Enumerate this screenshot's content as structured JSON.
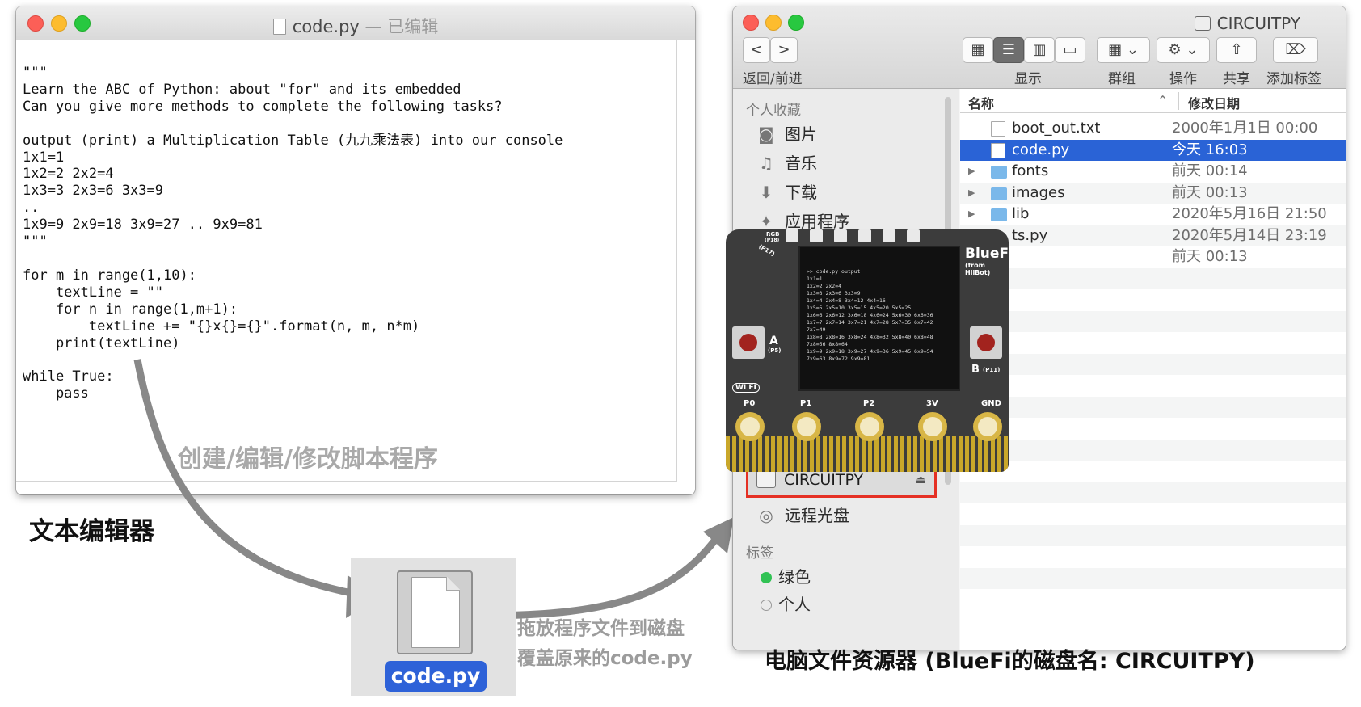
{
  "editor": {
    "title_file": "code.py",
    "title_status": " — 已编辑",
    "code_lines": [
      "\"\"\"",
      "Learn the ABC of Python: about \"for\" and its embedded",
      "Can you give more methods to complete the following tasks?",
      "",
      "output (print) a Multiplication Table (九九乘法表) into our console",
      "1x1=1",
      "1x2=2 2x2=4",
      "1x3=3 2x3=6 3x3=9",
      "..",
      "1x9=9 2x9=18 3x9=27 .. 9x9=81",
      "\"\"\"",
      "",
      "for m in range(1,10):",
      "    textLine = \"\"",
      "    for n in range(1,m+1):",
      "        textLine += \"{}x{}={}\".format(n, m, n*m)",
      "    print(textLine)",
      "",
      "while True:",
      "    pass"
    ],
    "caption": "创建/编辑/修改脚本程序",
    "label": "文本编辑器"
  },
  "drag": {
    "file_label": "code.py",
    "caption_line1": "拖放程序文件到磁盘",
    "caption_line2": "覆盖原来的code.py"
  },
  "finder": {
    "title": "CIRCUITPY",
    "toolbar": {
      "back": "<",
      "forward": ">",
      "back_forward_label": "返回/前进",
      "view_label": "显示",
      "group_label": "群组",
      "action_label": "操作",
      "share_label": "共享",
      "tag_label": "添加标签"
    },
    "sidebar": {
      "favorites_head": "个人收藏",
      "favorites": [
        {
          "icon": "camera-icon",
          "glyph": "◙",
          "label": "图片"
        },
        {
          "icon": "music-icon",
          "glyph": "♫",
          "label": "音乐"
        },
        {
          "icon": "download-icon",
          "glyph": "⬇",
          "label": "下载"
        },
        {
          "icon": "apps-icon",
          "glyph": "✦",
          "label": "应用程序"
        }
      ],
      "device": "CIRCUITPY",
      "eject": "⏏",
      "remote_disc": "远程光盘",
      "tags_head": "标签",
      "tag_green": "绿色",
      "tag_personal": "个人"
    },
    "list": {
      "col_name": "名称",
      "col_date": "修改日期",
      "rows": [
        {
          "type": "file",
          "name": "boot_out.txt",
          "date": "2000年1月1日 00:00",
          "expand": ""
        },
        {
          "type": "file",
          "name": "code.py",
          "date": "今天 16:03",
          "expand": ""
        },
        {
          "type": "folder",
          "name": "fonts",
          "date": "前天 00:14",
          "expand": "▶"
        },
        {
          "type": "folder",
          "name": "images",
          "date": "前天 00:13",
          "expand": "▶"
        },
        {
          "type": "folder",
          "name": "lib",
          "date": "2020年5月16日 21:50",
          "expand": "▶"
        },
        {
          "type": "file",
          "name": "ts.py",
          "date": "2020年5月14日 23:19",
          "expand": ""
        },
        {
          "type": "file",
          "name": "",
          "date": "前天 00:13",
          "expand": ""
        }
      ]
    },
    "caption": "电脑文件资源器 (BlueFi的磁盘名: CIRCUITPY)"
  },
  "board": {
    "name": "BlueFi",
    "maker": "(from HiiBot)",
    "rgb_label": "RGB",
    "rgb_pin": "(P18)",
    "p17": "(P17)",
    "wifi": "WI FI",
    "button_a": "A",
    "button_a_pin": "(P5)",
    "button_b": "B",
    "button_b_pin": "(P11)",
    "pins": [
      "P0",
      "P1",
      "P2",
      "3V",
      "GND"
    ],
    "screen_lines": [
      ">> code.py output:",
      "1x1=1",
      "1x2=2 2x2=4",
      "1x3=3 2x3=6 3x3=9",
      "1x4=4 2x4=8 3x4=12 4x4=16",
      "1x5=5 2x5=10 3x5=15 4x5=20 5x5=25",
      "1x6=6 2x6=12 3x6=18 4x6=24 5x6=30 6x6=36",
      "1x7=7 2x7=14 3x7=21 4x7=28 5x7=35 6x7=42",
      "7x7=49",
      "1x8=8 2x8=16 3x8=24 4x8=32 5x8=40 6x8=48",
      "7x8=56 8x8=64",
      "1x9=9 2x9=18 3x9=27 4x9=36 5x9=45 6x9=54",
      "7x9=63 8x9=72 9x9=81"
    ]
  },
  "colors": {
    "selection": "#2a63d6",
    "highlight_border": "#e53024",
    "arrow": "#888888"
  }
}
